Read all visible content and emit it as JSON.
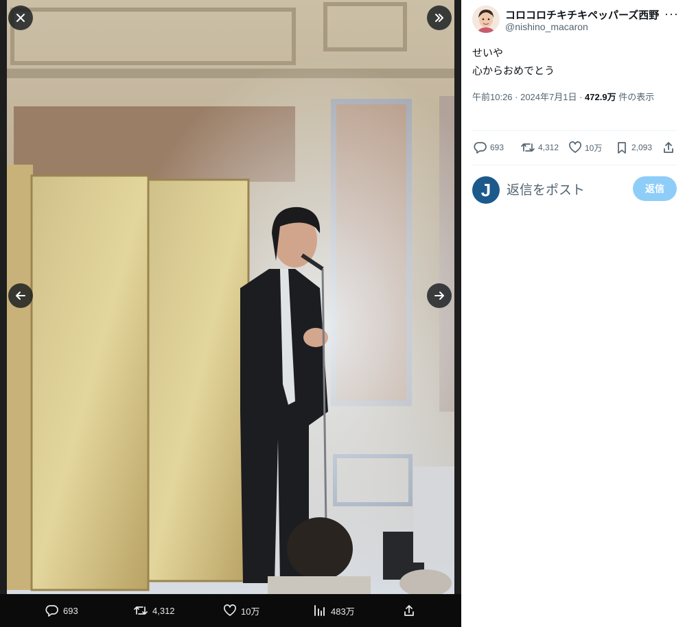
{
  "viewer": {
    "stats": {
      "replies": "693",
      "retweets": "4,312",
      "likes": "10万",
      "views": "483万"
    }
  },
  "tweet": {
    "display_name": "コロコロチキチキペッパーズ西野",
    "handle": "@nishino_macaron",
    "more": "···",
    "text_line1": "せいや",
    "text_line2": "心からおめでとう",
    "time": "午前10:26 · 2024年7月1日 · ",
    "views_count": "472.9万",
    "views_label": " 件の表示"
  },
  "actions": {
    "replies": "693",
    "retweets": "4,312",
    "likes": "10万",
    "bookmarks": "2,093"
  },
  "reply": {
    "avatar_letter": "J",
    "placeholder": "返信をポスト",
    "button": "返信"
  },
  "colors": {
    "accent": "#1d9bf0",
    "reply_button": "#8ecdf8",
    "viewer_bg": "#1e1e1e"
  }
}
